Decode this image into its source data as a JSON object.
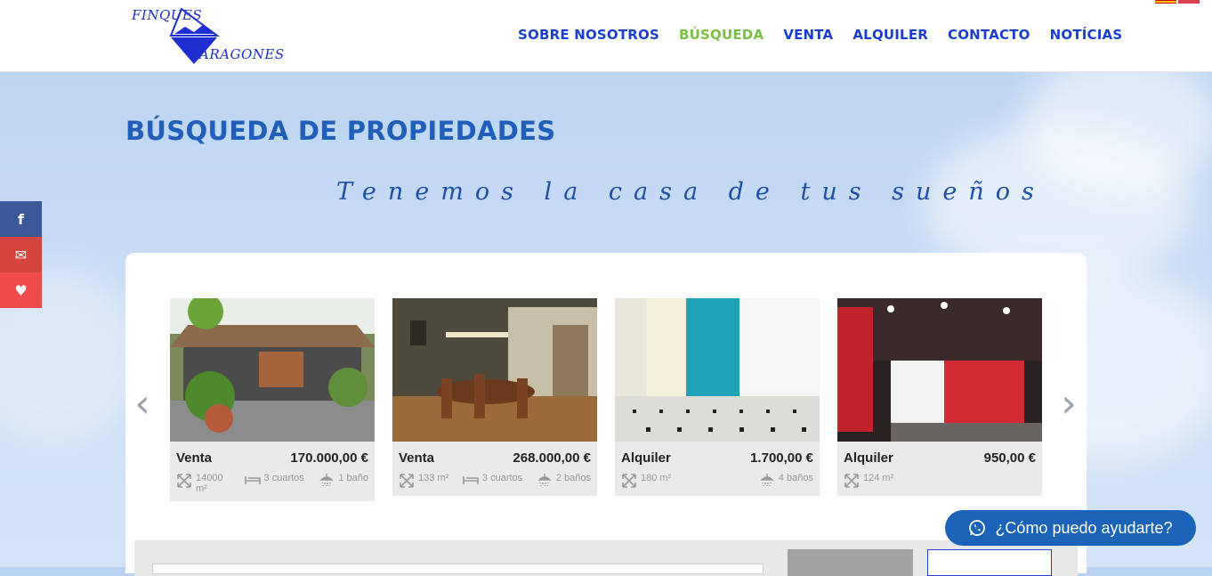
{
  "header": {
    "logo_line1": "FINQUES",
    "logo_line2": "ARAGONES",
    "nav": [
      {
        "label": "SOBRE NOSOTROS"
      },
      {
        "label": "BÚSQUEDA"
      },
      {
        "label": "VENTA"
      },
      {
        "label": "ALQUILER"
      },
      {
        "label": "CONTACTO"
      },
      {
        "label": "NOTÍCIAS"
      }
    ],
    "active_color": "#7ac143",
    "nav_color": "#1a3fd0"
  },
  "page": {
    "title": "BÚSQUEDA DE PROPIEDADES",
    "tagline": "Tenemos la casa de tus sueños"
  },
  "social": [
    {
      "icon": "facebook-icon",
      "glyph": "f",
      "color": "#3b5998"
    },
    {
      "icon": "email-icon",
      "glyph": "✉",
      "color": "#d54540"
    },
    {
      "icon": "heart-icon",
      "glyph": "♥",
      "color": "#f04a4a"
    }
  ],
  "carousel": {
    "prev": "‹",
    "next": "›",
    "cards": [
      {
        "type": "Venta",
        "price": "170.000,00 €",
        "area": "14000 m²",
        "rooms": "3 cuartos",
        "baths": "1 baño"
      },
      {
        "type": "Venta",
        "price": "268.000,00 €",
        "area": "133 m²",
        "rooms": "3 cuartos",
        "baths": "2 baños"
      },
      {
        "type": "Alquiler",
        "price": "1.700,00 €",
        "area": "180 m²",
        "rooms": "",
        "baths": "4 baños"
      },
      {
        "type": "Alquiler",
        "price": "950,00 €",
        "area": "124 m²",
        "rooms": "",
        "baths": ""
      }
    ]
  },
  "whatsapp": {
    "label": "¿Cómo puedo ayudarte?"
  }
}
